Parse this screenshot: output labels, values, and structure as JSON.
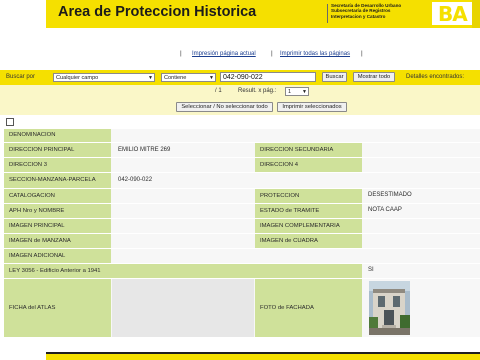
{
  "header": {
    "title": "Area de Proteccion Historica",
    "secretaria": [
      "Secretaría de Desarrollo Urbano",
      "Subsecretaría de Registros",
      "Interpretacion y Catastro"
    ],
    "logo_text": "BA"
  },
  "print_links": {
    "print_page": "Impresión página actual",
    "print_all": "Imprimir todas las páginas",
    "separator": "|"
  },
  "search": {
    "label": "Buscar por",
    "field_select": "Cualquier campo",
    "operator_select": "Contiene",
    "query_value": "042-090-022",
    "search_button": "Buscar",
    "show_all_button": "Mostrar todo",
    "results_label": "Detalles encontrados:"
  },
  "pager": {
    "page_of": "/ 1",
    "results_per_page_label": "Result. x pág.:",
    "results_per_page_value": "1"
  },
  "actions": {
    "select_toggle": "Seleccionar / No seleccionar todo",
    "print_selected": "Imprimir seleccionados"
  },
  "record": {
    "denominacion_label": "DENOMINACION",
    "denominacion_value": "",
    "dir_principal_label": "DIRECCION PRINCIPAL",
    "dir_principal_value": "EMILIO MITRE 269",
    "dir_secundaria_label": "DIRECCION SECUNDARIA",
    "dir_secundaria_value": "",
    "dir3_label": "DIRECCION 3",
    "dir4_label": "DIRECCION 4",
    "smp_label": "SECCION-MANZANA-PARCELA",
    "smp_value": "042-090-022",
    "catalogacion_label": "CATALOGACION",
    "catalogacion_value": "",
    "proteccion_label": "PROTECCION",
    "proteccion_value": "DESESTIMADO",
    "aph_label": "APH Nro y NOMBRE",
    "aph_value": "",
    "estado_label": "ESTADO de TRAMITE",
    "estado_value": "NOTA CAAP",
    "img_principal_label": "IMAGEN PRINCIPAL",
    "img_complementaria_label": "IMAGEN COMPLEMENTARIA",
    "img_manzana_label": "IMAGEN de MANZANA",
    "img_cuadra_label": "IMAGEN de CUADRA",
    "img_adicional_label": "IMAGEN ADICIONAL",
    "ley_label": "LEY 3056 - Edificio Anterior a 1941",
    "ley_value": "SI",
    "ficha_label": "FICHA del ATLAS",
    "foto_label": "FOTO de FACHADA"
  },
  "colors": {
    "brand_yellow": "#f5e000",
    "label_green": "#cfe19a",
    "link_blue": "#1a3d8f"
  }
}
